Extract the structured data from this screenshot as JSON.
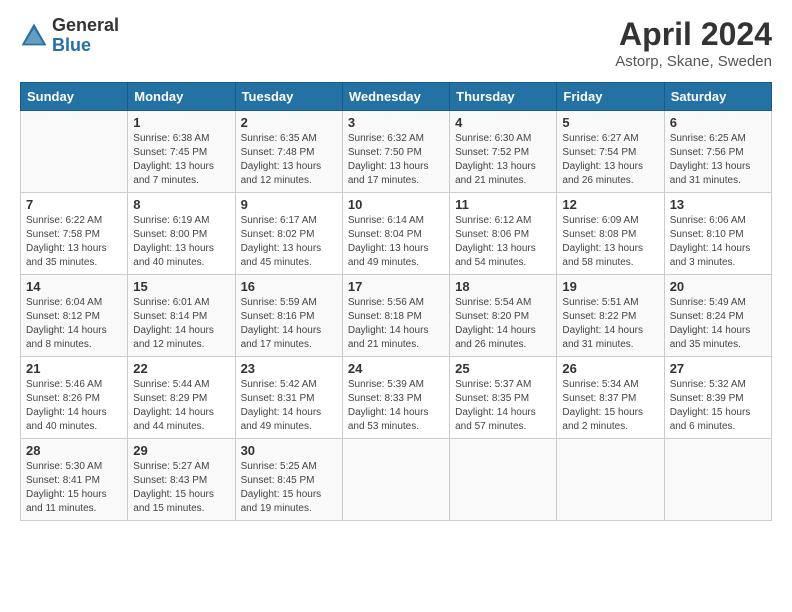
{
  "logo": {
    "general": "General",
    "blue": "Blue"
  },
  "title": "April 2024",
  "subtitle": "Astorp, Skane, Sweden",
  "days_of_week": [
    "Sunday",
    "Monday",
    "Tuesday",
    "Wednesday",
    "Thursday",
    "Friday",
    "Saturday"
  ],
  "weeks": [
    [
      {
        "day": "",
        "sunrise": "",
        "sunset": "",
        "daylight": ""
      },
      {
        "day": "1",
        "sunrise": "Sunrise: 6:38 AM",
        "sunset": "Sunset: 7:45 PM",
        "daylight": "Daylight: 13 hours and 7 minutes."
      },
      {
        "day": "2",
        "sunrise": "Sunrise: 6:35 AM",
        "sunset": "Sunset: 7:48 PM",
        "daylight": "Daylight: 13 hours and 12 minutes."
      },
      {
        "day": "3",
        "sunrise": "Sunrise: 6:32 AM",
        "sunset": "Sunset: 7:50 PM",
        "daylight": "Daylight: 13 hours and 17 minutes."
      },
      {
        "day": "4",
        "sunrise": "Sunrise: 6:30 AM",
        "sunset": "Sunset: 7:52 PM",
        "daylight": "Daylight: 13 hours and 21 minutes."
      },
      {
        "day": "5",
        "sunrise": "Sunrise: 6:27 AM",
        "sunset": "Sunset: 7:54 PM",
        "daylight": "Daylight: 13 hours and 26 minutes."
      },
      {
        "day": "6",
        "sunrise": "Sunrise: 6:25 AM",
        "sunset": "Sunset: 7:56 PM",
        "daylight": "Daylight: 13 hours and 31 minutes."
      }
    ],
    [
      {
        "day": "7",
        "sunrise": "Sunrise: 6:22 AM",
        "sunset": "Sunset: 7:58 PM",
        "daylight": "Daylight: 13 hours and 35 minutes."
      },
      {
        "day": "8",
        "sunrise": "Sunrise: 6:19 AM",
        "sunset": "Sunset: 8:00 PM",
        "daylight": "Daylight: 13 hours and 40 minutes."
      },
      {
        "day": "9",
        "sunrise": "Sunrise: 6:17 AM",
        "sunset": "Sunset: 8:02 PM",
        "daylight": "Daylight: 13 hours and 45 minutes."
      },
      {
        "day": "10",
        "sunrise": "Sunrise: 6:14 AM",
        "sunset": "Sunset: 8:04 PM",
        "daylight": "Daylight: 13 hours and 49 minutes."
      },
      {
        "day": "11",
        "sunrise": "Sunrise: 6:12 AM",
        "sunset": "Sunset: 8:06 PM",
        "daylight": "Daylight: 13 hours and 54 minutes."
      },
      {
        "day": "12",
        "sunrise": "Sunrise: 6:09 AM",
        "sunset": "Sunset: 8:08 PM",
        "daylight": "Daylight: 13 hours and 58 minutes."
      },
      {
        "day": "13",
        "sunrise": "Sunrise: 6:06 AM",
        "sunset": "Sunset: 8:10 PM",
        "daylight": "Daylight: 14 hours and 3 minutes."
      }
    ],
    [
      {
        "day": "14",
        "sunrise": "Sunrise: 6:04 AM",
        "sunset": "Sunset: 8:12 PM",
        "daylight": "Daylight: 14 hours and 8 minutes."
      },
      {
        "day": "15",
        "sunrise": "Sunrise: 6:01 AM",
        "sunset": "Sunset: 8:14 PM",
        "daylight": "Daylight: 14 hours and 12 minutes."
      },
      {
        "day": "16",
        "sunrise": "Sunrise: 5:59 AM",
        "sunset": "Sunset: 8:16 PM",
        "daylight": "Daylight: 14 hours and 17 minutes."
      },
      {
        "day": "17",
        "sunrise": "Sunrise: 5:56 AM",
        "sunset": "Sunset: 8:18 PM",
        "daylight": "Daylight: 14 hours and 21 minutes."
      },
      {
        "day": "18",
        "sunrise": "Sunrise: 5:54 AM",
        "sunset": "Sunset: 8:20 PM",
        "daylight": "Daylight: 14 hours and 26 minutes."
      },
      {
        "day": "19",
        "sunrise": "Sunrise: 5:51 AM",
        "sunset": "Sunset: 8:22 PM",
        "daylight": "Daylight: 14 hours and 31 minutes."
      },
      {
        "day": "20",
        "sunrise": "Sunrise: 5:49 AM",
        "sunset": "Sunset: 8:24 PM",
        "daylight": "Daylight: 14 hours and 35 minutes."
      }
    ],
    [
      {
        "day": "21",
        "sunrise": "Sunrise: 5:46 AM",
        "sunset": "Sunset: 8:26 PM",
        "daylight": "Daylight: 14 hours and 40 minutes."
      },
      {
        "day": "22",
        "sunrise": "Sunrise: 5:44 AM",
        "sunset": "Sunset: 8:29 PM",
        "daylight": "Daylight: 14 hours and 44 minutes."
      },
      {
        "day": "23",
        "sunrise": "Sunrise: 5:42 AM",
        "sunset": "Sunset: 8:31 PM",
        "daylight": "Daylight: 14 hours and 49 minutes."
      },
      {
        "day": "24",
        "sunrise": "Sunrise: 5:39 AM",
        "sunset": "Sunset: 8:33 PM",
        "daylight": "Daylight: 14 hours and 53 minutes."
      },
      {
        "day": "25",
        "sunrise": "Sunrise: 5:37 AM",
        "sunset": "Sunset: 8:35 PM",
        "daylight": "Daylight: 14 hours and 57 minutes."
      },
      {
        "day": "26",
        "sunrise": "Sunrise: 5:34 AM",
        "sunset": "Sunset: 8:37 PM",
        "daylight": "Daylight: 15 hours and 2 minutes."
      },
      {
        "day": "27",
        "sunrise": "Sunrise: 5:32 AM",
        "sunset": "Sunset: 8:39 PM",
        "daylight": "Daylight: 15 hours and 6 minutes."
      }
    ],
    [
      {
        "day": "28",
        "sunrise": "Sunrise: 5:30 AM",
        "sunset": "Sunset: 8:41 PM",
        "daylight": "Daylight: 15 hours and 11 minutes."
      },
      {
        "day": "29",
        "sunrise": "Sunrise: 5:27 AM",
        "sunset": "Sunset: 8:43 PM",
        "daylight": "Daylight: 15 hours and 15 minutes."
      },
      {
        "day": "30",
        "sunrise": "Sunrise: 5:25 AM",
        "sunset": "Sunset: 8:45 PM",
        "daylight": "Daylight: 15 hours and 19 minutes."
      },
      {
        "day": "",
        "sunrise": "",
        "sunset": "",
        "daylight": ""
      },
      {
        "day": "",
        "sunrise": "",
        "sunset": "",
        "daylight": ""
      },
      {
        "day": "",
        "sunrise": "",
        "sunset": "",
        "daylight": ""
      },
      {
        "day": "",
        "sunrise": "",
        "sunset": "",
        "daylight": ""
      }
    ]
  ]
}
